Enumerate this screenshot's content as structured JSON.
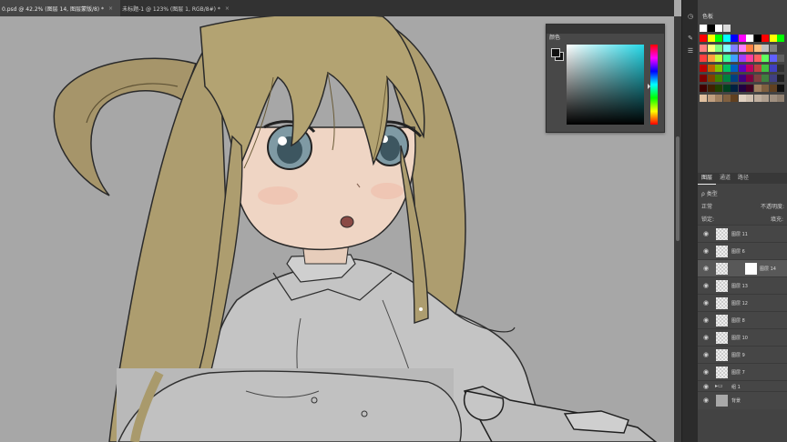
{
  "tabs": [
    {
      "label": "0.psd @ 42.2% (图层 14, 图层蒙版/8) *",
      "active": true
    },
    {
      "label": "未标题-1 @ 123% (图层 1, RGB/8#) *",
      "active": false
    }
  ],
  "tab_close": "×",
  "color_panel": {
    "title": "颜色",
    "foreground": "#111111",
    "background": "#111111",
    "hue_color": "#25d8e8"
  },
  "swatches": {
    "title": "色板"
  },
  "layers_panel": {
    "tabs": [
      "图层",
      "通道",
      "路径"
    ],
    "filter_label": "ρ 类型",
    "blend_mode": "正常",
    "opacity_label": "不透明度:",
    "lock_label": "锁定:",
    "fill_label": "填充:",
    "layers": [
      {
        "name": "图层 11"
      },
      {
        "name": "图层 6"
      },
      {
        "name": "图层 14",
        "selected": true
      },
      {
        "name": "图层 13"
      },
      {
        "name": "图层 12"
      },
      {
        "name": "图层 8"
      },
      {
        "name": "图层 10"
      },
      {
        "name": "图层 9"
      },
      {
        "name": "图层 7"
      },
      {
        "name": "组 1"
      },
      {
        "name": "背景"
      }
    ]
  }
}
